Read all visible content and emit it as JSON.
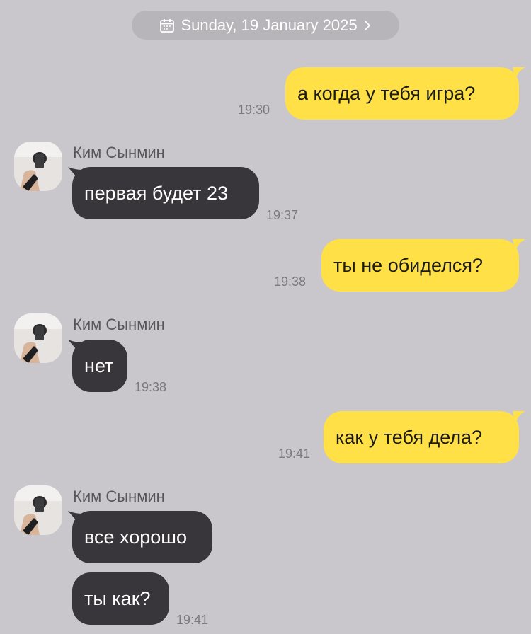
{
  "date_header": {
    "label": "Sunday, 19 January 2025"
  },
  "messages": [
    {
      "id": "m1",
      "direction": "out",
      "text": "а когда у тебя игра?",
      "time": "19:30"
    },
    {
      "id": "m2",
      "direction": "in",
      "sender": "Ким Сынмин",
      "text": "первая будет 23",
      "time": "19:37"
    },
    {
      "id": "m3",
      "direction": "out",
      "text": "ты не обиделся?",
      "time": "19:38"
    },
    {
      "id": "m4",
      "direction": "in",
      "sender": "Ким Сынмин",
      "text": "нет",
      "time": "19:38"
    },
    {
      "id": "m5",
      "direction": "out",
      "text": "как у тебя дела?",
      "time": "19:41"
    },
    {
      "id": "m6",
      "direction": "in",
      "sender": "Ким Сынмин",
      "text": "все хорошо",
      "time": ""
    },
    {
      "id": "m7",
      "direction": "in",
      "sender": "",
      "text": "ты как?",
      "time": "19:41"
    }
  ],
  "colors": {
    "background": "#c9c7cc",
    "outgoing_bubble": "#ffe046",
    "incoming_bubble": "#38363b",
    "timestamp": "#7b797e",
    "date_pill": "#b7b5ba"
  },
  "icons": {
    "date_pill_left": "calendar-icon",
    "date_pill_right": "chevron-right-icon"
  }
}
